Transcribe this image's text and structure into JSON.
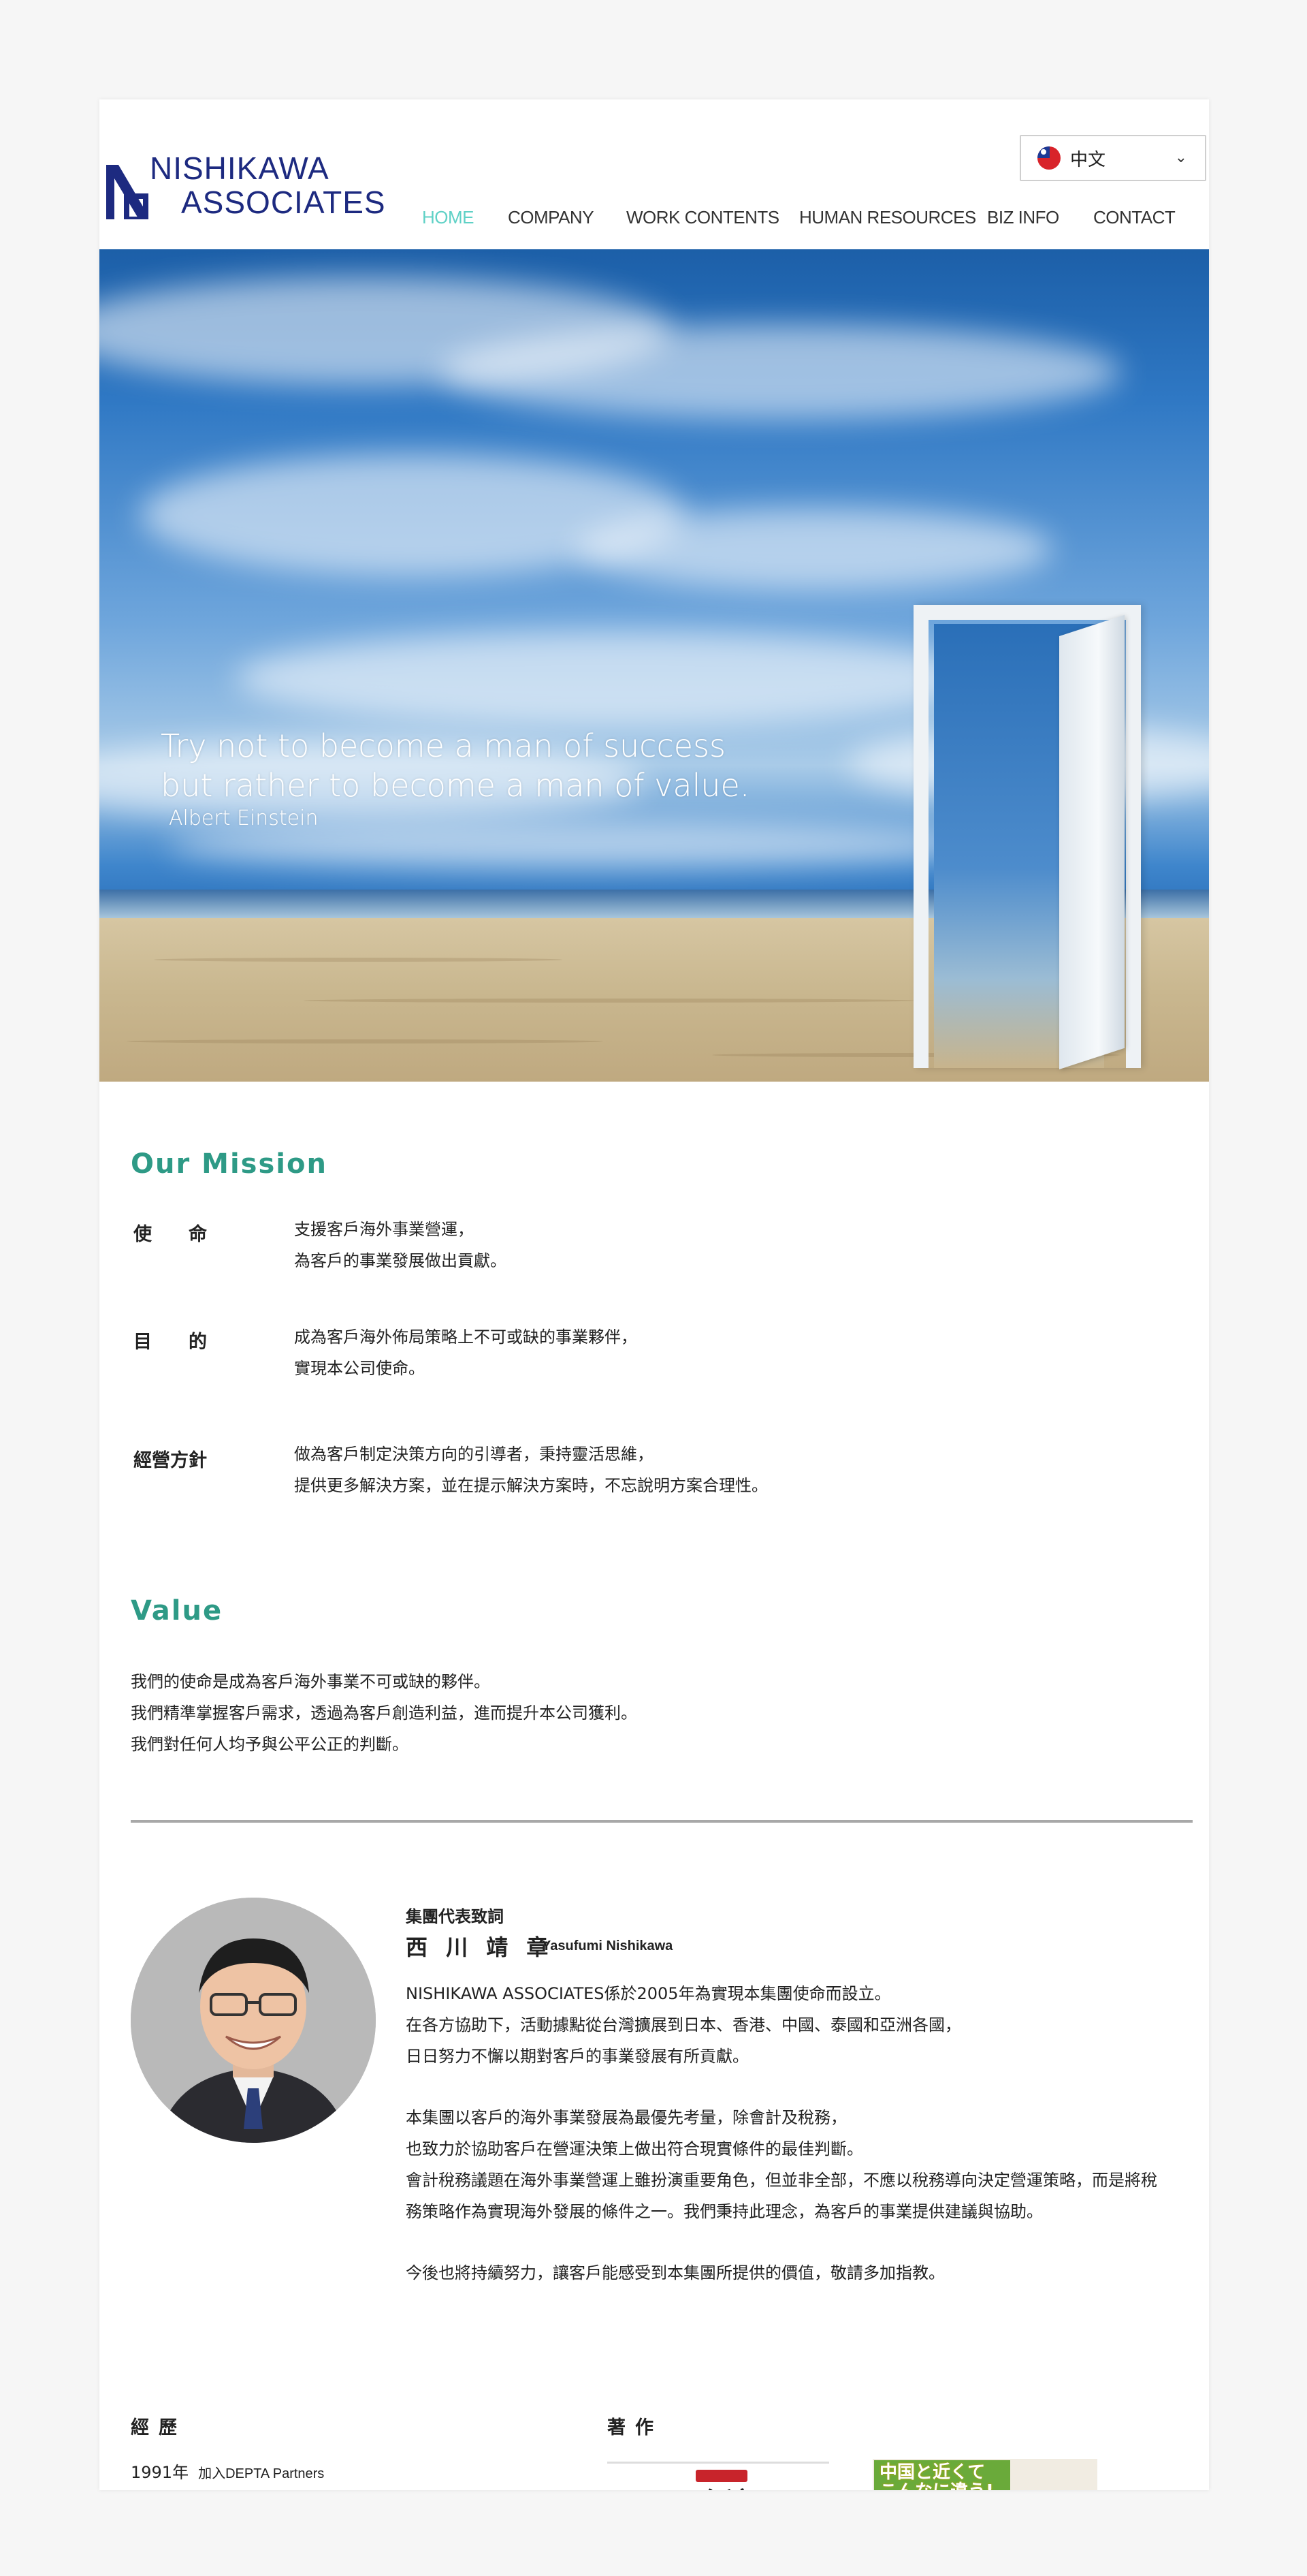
{
  "header": {
    "logo_line1": "NISHIKAWA",
    "logo_line2": "ASSOCIATES",
    "language": {
      "selected": "中文",
      "icon": "taiwan-flag-icon"
    },
    "nav": [
      "HOME",
      "COMPANY",
      "WORK CONTENTS",
      "HUMAN RESOURCES",
      "BIZ INFO",
      "CONTACT"
    ],
    "nav_active_color": "#5fd1c6"
  },
  "hero": {
    "quote_line1": "Try not to become a man of success",
    "quote_line2": "but rather to become a man of value.",
    "author": "Albert Einstein"
  },
  "mission": {
    "heading": "Our Mission",
    "items": [
      {
        "label": "使　　命",
        "lines": [
          "支援客戶海外事業營運，",
          "為客戶的事業發展做出貢獻。"
        ]
      },
      {
        "label": "目　　的",
        "lines": [
          "成為客戶海外佈局策略上不可或缺的事業夥伴，",
          "實現本公司使命。"
        ]
      },
      {
        "label": "經營方針",
        "lines": [
          "做為客戶制定決策方向的引導者，秉持靈活思維，",
          "提供更多解決方案，並在提示解決方案時，不忘說明方案合理性。"
        ]
      }
    ]
  },
  "value": {
    "heading": "Value",
    "lines": [
      "我們的使命是成為客戶海外事業不可或缺的夥伴。",
      "我們精準掌握客戶需求，透過為客戶創造利益，進而提升本公司獲利。",
      "我們對任何人均予與公平公正的判斷。"
    ]
  },
  "representative": {
    "title": "集團代表致詞",
    "name": "西 川 靖 章",
    "name_en": "Yasufumi Nishikawa",
    "paragraphs": [
      [
        "NISHIKAWA ASSOCIATES係於2005年為實現本集團使命而設立。",
        "在各方協助下，活動據點從台灣擴展到日本、香港、中國、泰國和亞洲各國，",
        "日日努力不懈以期對客戶的事業發展有所貢獻。"
      ],
      [
        "本集團以客戶的海外事業發展為最優先考量，除會計及稅務，",
        "也致力於協助客戶在營運決策上做出符合現實條件的最佳判斷。",
        "會計稅務議題在海外事業營運上雖扮演重要角色，但並非全部，不應以稅務導向決定營運策略，而是將稅",
        "務策略作為實現海外發展的條件之一。我們秉持此理念，為客戶的事業提供建議與協助。"
      ],
      [
        "今後也將持續努力，讓客戶能感受到本集團所提供的價值，敬請多加指教。"
      ]
    ]
  },
  "bottom": {
    "history_heading": "經歷",
    "history_year": "1991年",
    "history_item": "加入DEPTA Partners",
    "works_heading": "著作",
    "book1_title": "台湾",
    "book2_title_l1": "中国と近くて",
    "book2_title_l2": "こんなに違う!"
  }
}
